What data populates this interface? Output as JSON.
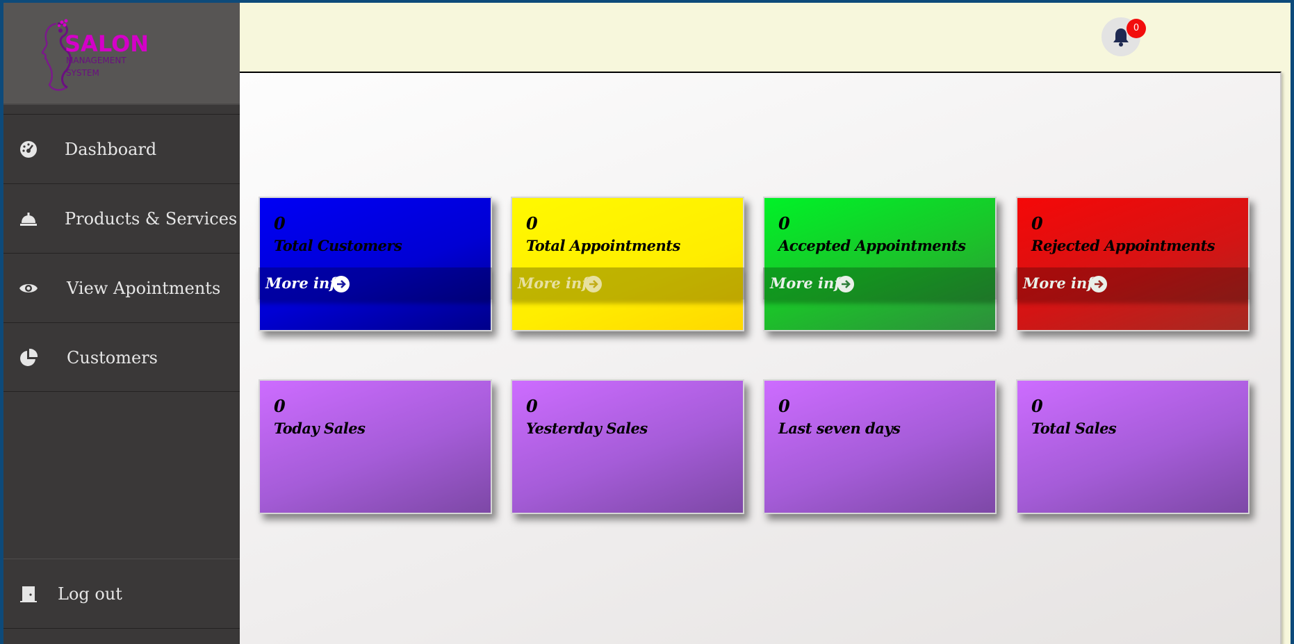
{
  "brand": {
    "name": "SALON",
    "subtitle_line1": "MANAGEMENT",
    "subtitle_line2": "SYSTEM",
    "color": "#d400c8"
  },
  "sidebar": {
    "items": [
      {
        "label": "Dashboard",
        "icon": "dashboard-gauge-icon"
      },
      {
        "label": "Products & Services",
        "icon": "concierge-bell-icon"
      },
      {
        "label": "View Apointments",
        "icon": "eye-icon"
      },
      {
        "label": "Customers",
        "icon": "pie-chart-icon"
      }
    ],
    "logout": {
      "label": "Log out",
      "icon": "door-icon"
    }
  },
  "header": {
    "notifications": {
      "icon": "bell-icon",
      "count": "0"
    }
  },
  "cards_row1": [
    {
      "count": "0",
      "label": "Total Customers",
      "more": "More info",
      "color": "#0000f5"
    },
    {
      "count": "0",
      "label": "Total Appointments",
      "more": "More info",
      "color": "#ffef00"
    },
    {
      "count": "0",
      "label": "Accepted Appointments",
      "more": "More info",
      "color": "#1cc12a"
    },
    {
      "count": "0",
      "label": "Rejected Appointments",
      "more": "More info",
      "color": "#d41414"
    }
  ],
  "cards_row2": [
    {
      "count": "0",
      "label": "Today Sales",
      "color": "#a55cd8"
    },
    {
      "count": "0",
      "label": "Yesterday Sales",
      "color": "#a55cd8"
    },
    {
      "count": "0",
      "label": "Last seven days",
      "color": "#a55cd8"
    },
    {
      "count": "0",
      "label": "Total Sales",
      "color": "#a55cd8"
    }
  ]
}
